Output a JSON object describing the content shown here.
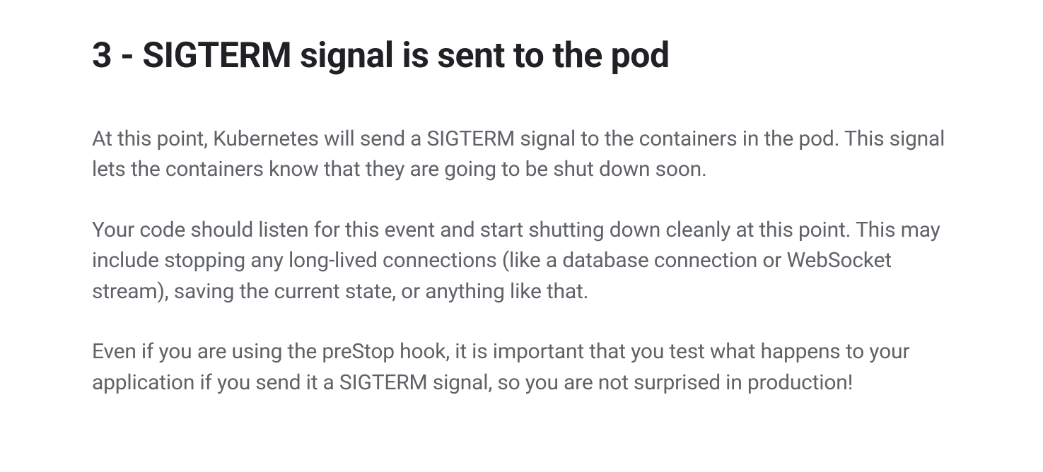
{
  "heading": "3 - SIGTERM signal is sent to the pod",
  "paragraphs": {
    "p1": "At this point, Kubernetes will send a SIGTERM signal to the containers in the pod. This signal lets the containers know that they are going to be shut down soon.",
    "p2": "Your code should listen for this event and start shutting down cleanly at this point. This may include stopping any long-lived connections (like a database connection or WebSocket stream), saving the current state, or anything like that.",
    "p3": "Even if you are using the preStop hook, it is important that you test what happens to your application if you send it a SIGTERM signal, so you are not surprised in production!"
  }
}
